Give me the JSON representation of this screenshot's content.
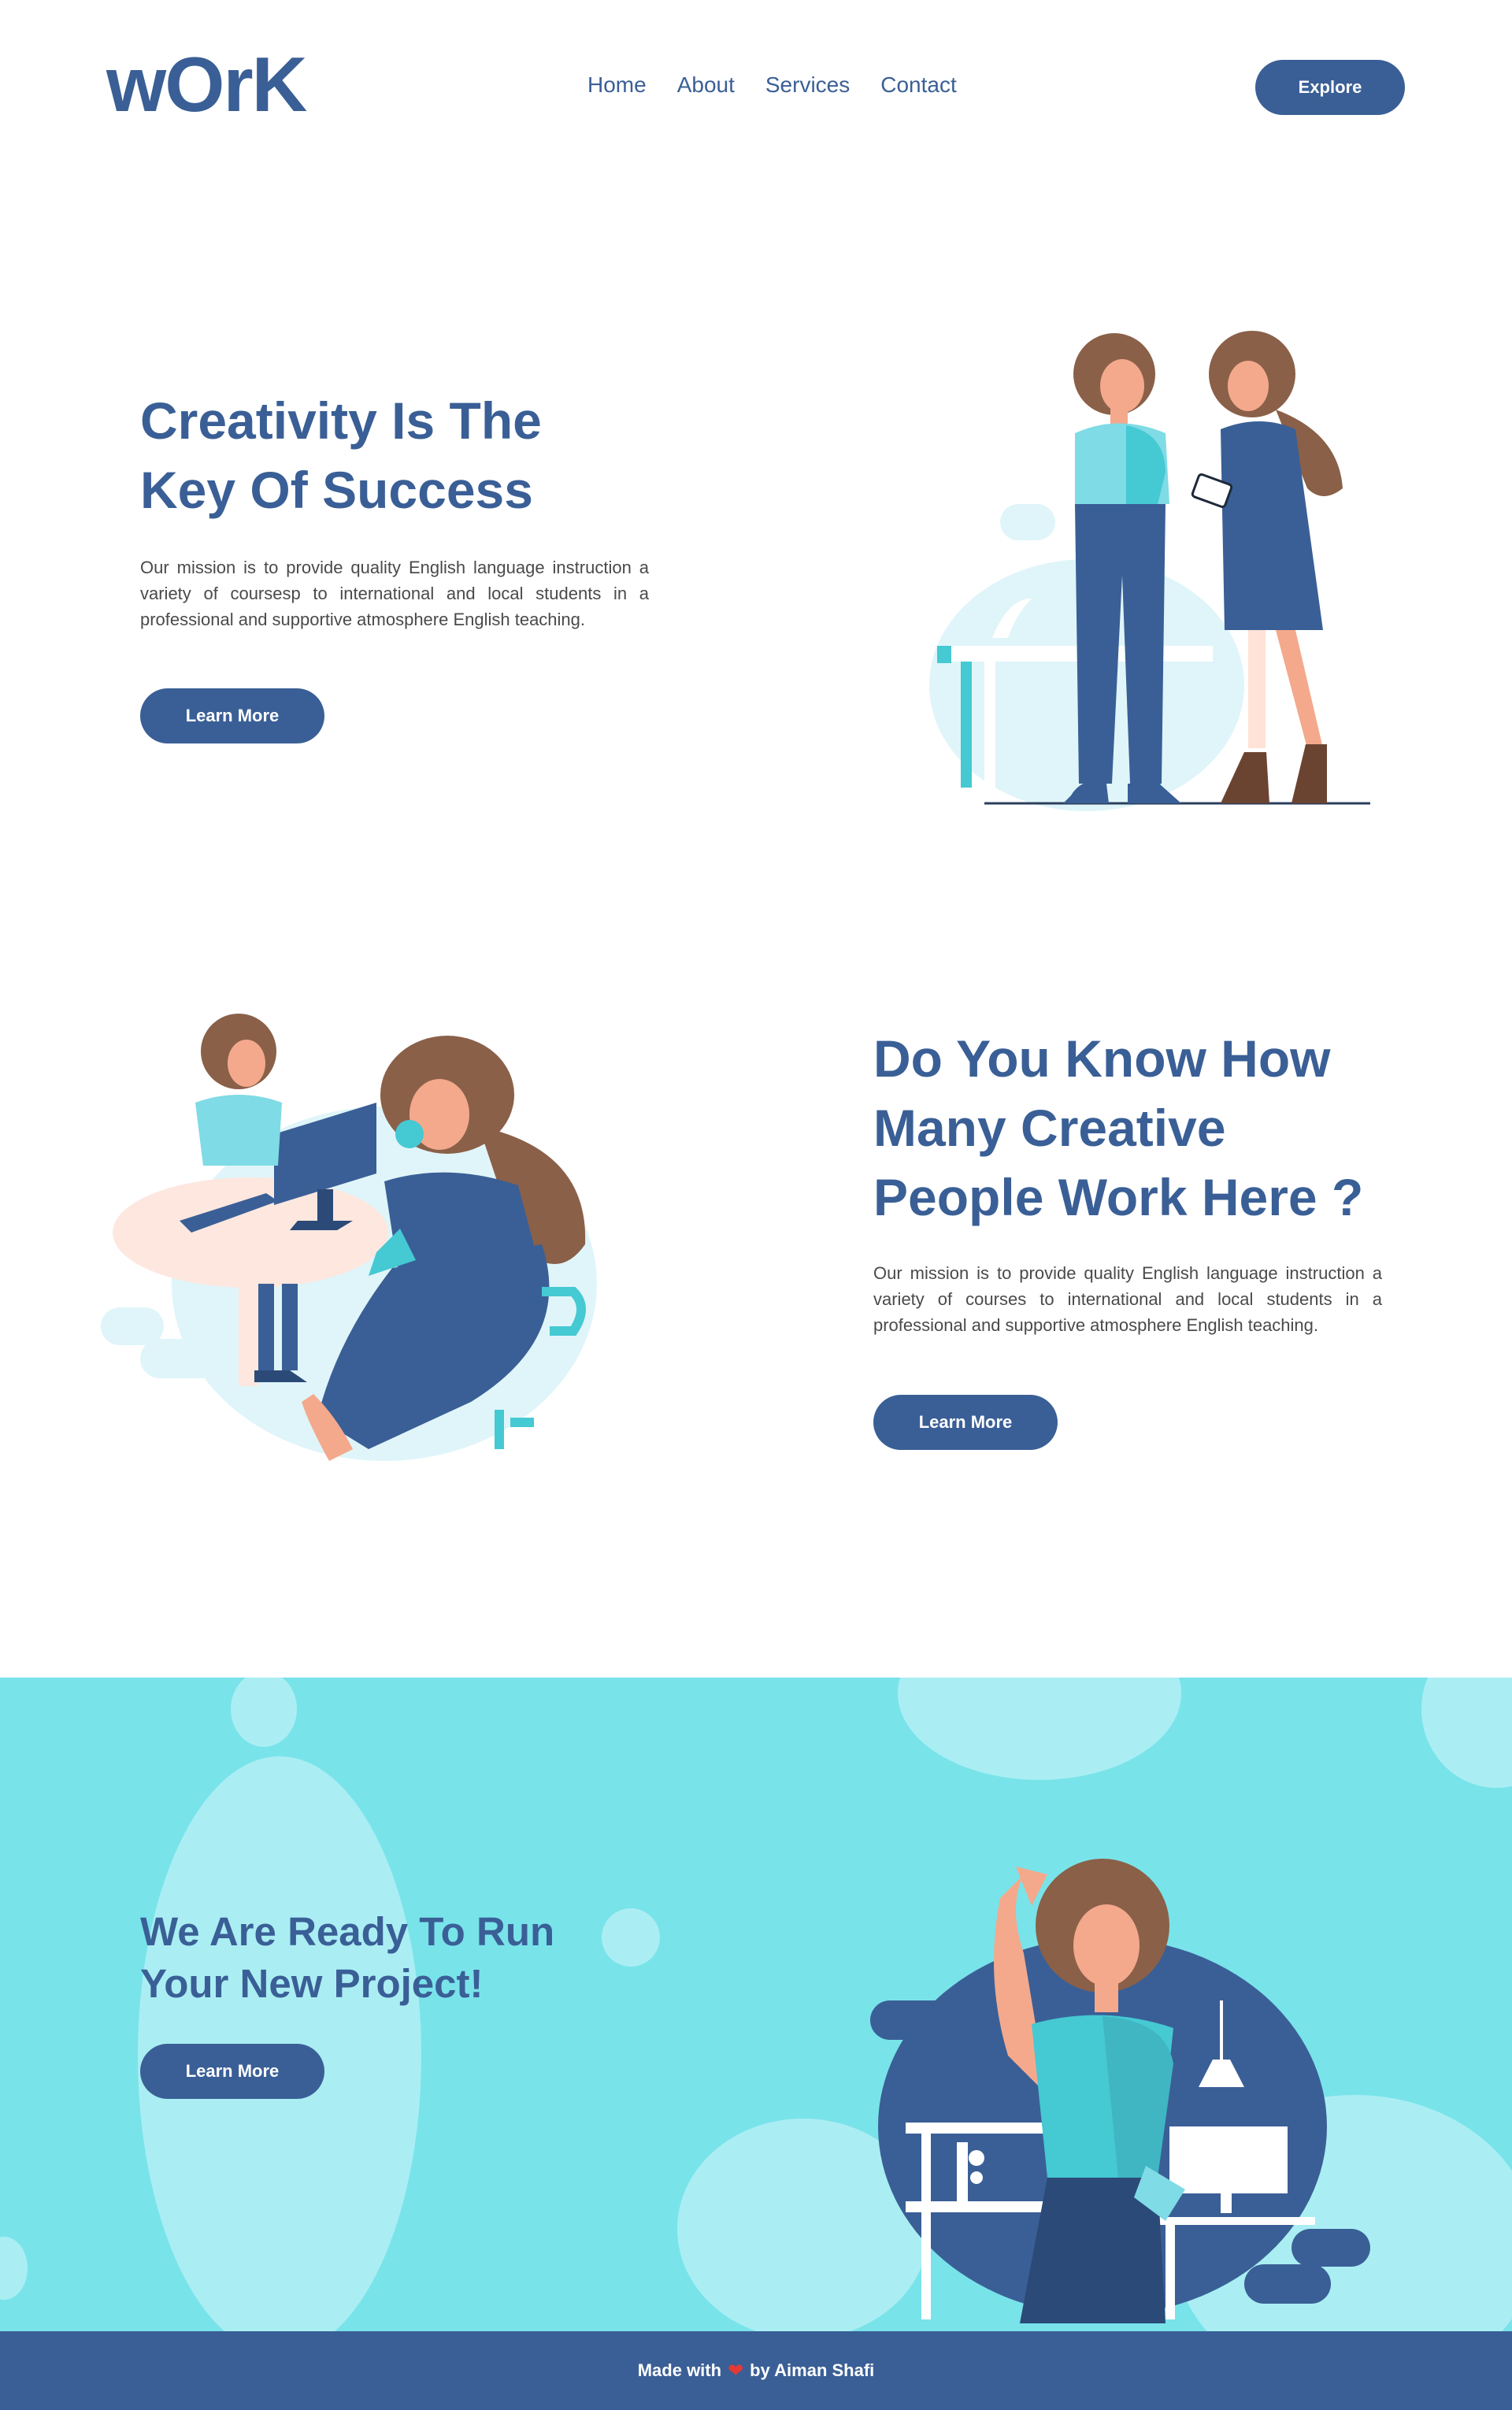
{
  "header": {
    "logo": "wOrK",
    "nav": [
      "Home",
      "About",
      "Services",
      "Contact"
    ],
    "explore_label": "Explore"
  },
  "hero": {
    "title_line1": "Creativity Is The",
    "title_line2": "Key Of Success",
    "text": "Our mission is to provide quality English language instruction a variety of coursesp to international and local students in a professional and supportive atmosphere English teaching.",
    "button": "Learn More"
  },
  "section2": {
    "title_line1": "Do You Know How",
    "title_line2": "Many Creative",
    "title_line3": "People Work Here ?",
    "text": "Our mission is to provide quality English language instruction a variety of courses to international and local students in a professional and supportive atmosphere English teaching.",
    "button": "Learn More"
  },
  "cta": {
    "title_line1": "We Are Ready To Run",
    "title_line2": "Your New Project!",
    "button": "Learn More"
  },
  "footer": {
    "made_with": "Made with",
    "by": "by Aiman Shafi",
    "heart_icon": "heart-icon"
  },
  "colors": {
    "primary": "#3a5f96",
    "cyan": "#79e3ea",
    "light_cyan": "#aaeef3",
    "pale": "#e0f5f9",
    "skin": "#f4a98c",
    "hair": "#8a6048",
    "heart": "#e53935"
  }
}
